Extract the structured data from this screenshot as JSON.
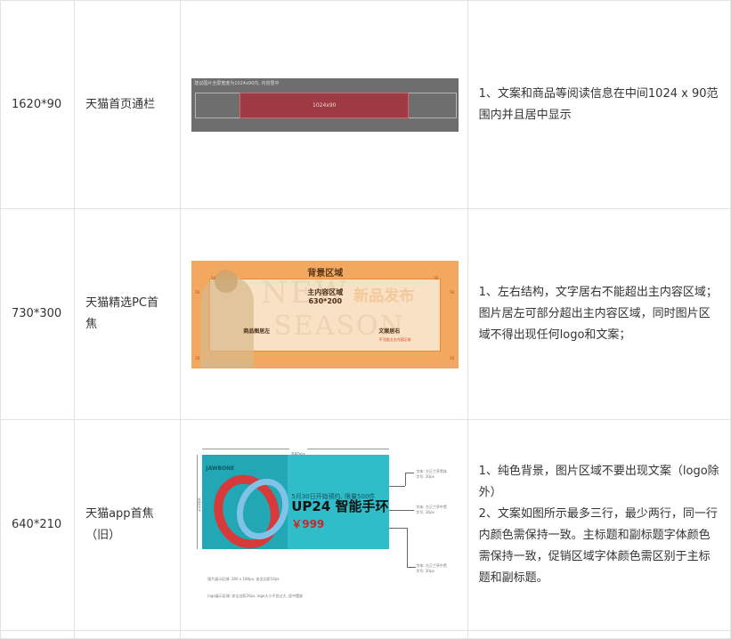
{
  "rows": [
    {
      "size": "1620*90",
      "name": "天猫首页通栏",
      "image": {
        "caption": "建议图片全屏宽度为1024x90内, 内容居中",
        "inner_label": "1024x90"
      },
      "notes": [
        "1、文案和商品等阅读信息在中间1024 x 90范围内并且居中显示"
      ]
    },
    {
      "size": "730*300",
      "name": "天猫精选PC首焦",
      "image": {
        "bg_title": "背景区域",
        "main_label": "主内容区域",
        "main_size": "630*200",
        "img_label": "商品图居左",
        "txt_label": "文案居右",
        "txt_sub": "不可超出主内容区域",
        "wm_en1": "NEW",
        "wm_en2": "SEASON",
        "wm_cn": "新品发布",
        "ticks": [
          "50",
          "50",
          "50",
          "50",
          "50",
          "50"
        ]
      },
      "notes": [
        "1、左右结构，文字居右不能超出主内容区域；图片居左可部分超出主内容区域，同时图片区域不得出现任何logo和文案；"
      ]
    },
    {
      "size": "640*210",
      "name": "天猫app首焦（旧）",
      "image": {
        "top_dim": "640px",
        "side_dim": "210px",
        "brand": "JAWBONE",
        "promo": "5月30日开始预约, 限量500件",
        "title": "UP24 智能手环",
        "price": "￥999",
        "ann1": "字号: 20px",
        "ann1_head": "字体: 方正兰亭黑体",
        "ann2": "字号: 36px",
        "ann2_head": "字体: 方正兰亭中黑",
        "ann3": "字号: 30px",
        "ann3_head": "字体: 方正兰亭中黑",
        "foot1": "图片展示区域: 280 x 180px, 安全边距10px",
        "foot2": "logo展示区域: 安全边距20px, logo大小不宜过大, 居中摆放"
      },
      "notes": [
        "1、纯色背景，图片区域不要出现文案（logo除外）",
        "2、文案如图所示最多三行，最少两行，同一行内颜色需保持一致。主标题和副标题字体颜色需保持一致，促销区域字体颜色需区别于主标题和副标题。"
      ]
    }
  ]
}
